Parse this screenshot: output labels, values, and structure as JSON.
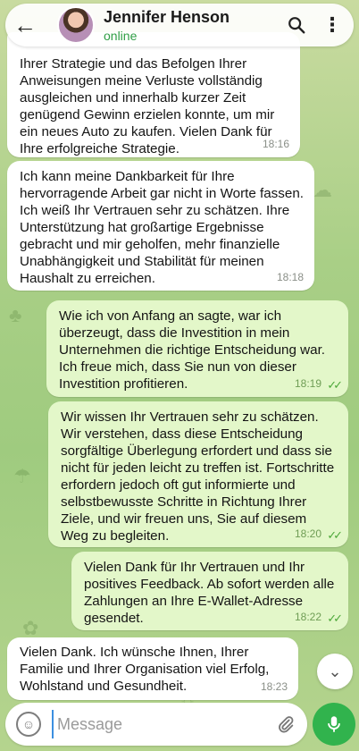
{
  "header": {
    "back_icon": "arrow-left-icon",
    "contact_name": "Jennifer Henson",
    "status": "online",
    "search_icon": "search-icon",
    "menu_icon": "more-vertical-icon"
  },
  "messages": [
    {
      "direction": "in",
      "text": "Ihrer Strategie und das Befolgen Ihrer Anweisungen meine Verluste vollständig ausgleichen und innerhalb kurzer Zeit genügend Gewinn erzielen konnte, um mir ein neues Auto zu kaufen. Vielen Dank für Ihre erfolgreiche Strategie.",
      "time": "18:16"
    },
    {
      "direction": "in",
      "text": "Ich kann meine Dankbarkeit für Ihre hervorragende Arbeit gar nicht in Worte fassen. Ich weiß Ihr Vertrauen sehr zu schätzen. Ihre Unterstützung hat großartige Ergebnisse gebracht und mir geholfen, mehr finanzielle Unabhängigkeit und Stabilität für meinen Haushalt zu erreichen.",
      "time": "18:18"
    },
    {
      "direction": "out",
      "text": "Wie ich von Anfang an sagte, war ich überzeugt, dass die Investition in mein Unternehmen die richtige Entscheidung war. Ich freue mich, dass Sie nun von dieser Investition profitieren.",
      "time": "18:19",
      "read": true
    },
    {
      "direction": "out",
      "text": "Wir wissen Ihr Vertrauen sehr zu schätzen. Wir verstehen, dass diese Entscheidung sorgfältige Überlegung erfordert und dass sie nicht für jeden leicht zu treffen ist. Fortschritte erfordern jedoch oft gut informierte und selbstbewusste Schritte in Richtung Ihrer Ziele, und wir freuen uns, Sie auf diesem Weg zu begleiten.",
      "time": "18:20",
      "read": true
    },
    {
      "direction": "out",
      "text": "Vielen Dank für Ihr Vertrauen und Ihr positives Feedback. Ab sofort werden alle Zahlungen an Ihre E-Wallet-Adresse gesendet.",
      "time": "18:22",
      "read": true
    },
    {
      "direction": "in",
      "text": "Vielen Dank. Ich wünsche Ihnen, Ihrer Familie und Ihrer Organisation viel Erfolg, Wohlstand und Gesundheit.",
      "time": "18:23"
    }
  ],
  "read_ticks": "✓✓",
  "scroll_down_icon": "chevron-down-icon",
  "composer": {
    "placeholder": "Message",
    "emoji_icon": "smiley-icon",
    "attach_icon": "paperclip-icon",
    "mic_icon": "microphone-icon"
  },
  "colors": {
    "incoming_bubble": "#ffffff",
    "outgoing_bubble": "#e3f7c9",
    "online_status": "#2f9e44",
    "mic_button": "#31b34d"
  }
}
